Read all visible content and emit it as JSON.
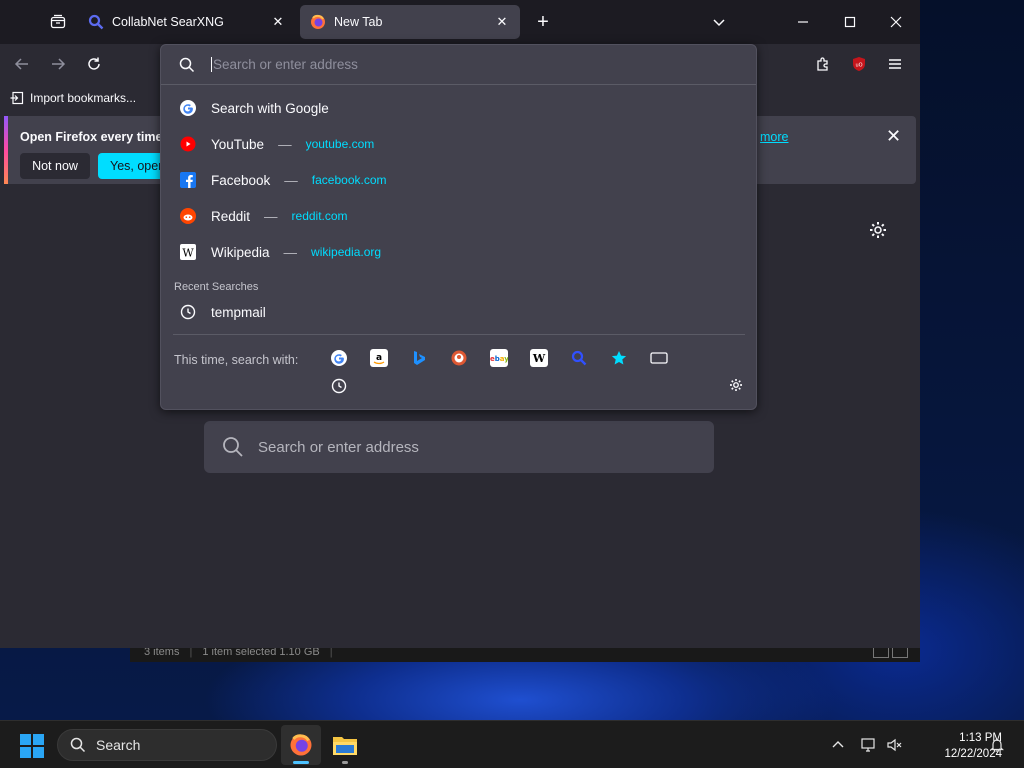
{
  "tabs": [
    {
      "title": "CollabNet SearXNG",
      "active": false
    },
    {
      "title": "New Tab",
      "active": true
    }
  ],
  "bookmarks": {
    "import_label": "Import bookmarks..."
  },
  "notification": {
    "message": "Open Firefox every time y",
    "link": "more",
    "not_now": "Not now",
    "yes": "Yes, open"
  },
  "urlbar": {
    "placeholder": "Search or enter address",
    "search_with_google": "Search with Google",
    "suggestions": [
      {
        "name": "YouTube",
        "url": "youtube.com",
        "icon": "youtube-icon"
      },
      {
        "name": "Facebook",
        "url": "facebook.com",
        "icon": "facebook-icon"
      },
      {
        "name": "Reddit",
        "url": "reddit.com",
        "icon": "reddit-icon"
      },
      {
        "name": "Wikipedia",
        "url": "wikipedia.org",
        "icon": "wikipedia-icon"
      }
    ],
    "separator": "—",
    "recent_label": "Recent Searches",
    "recent": [
      {
        "text": "tempmail"
      }
    ],
    "one_offs_label": "This time, search with:",
    "engines": [
      "google-icon",
      "amazon-icon",
      "bing-icon",
      "duckduckgo-icon",
      "ebay-icon",
      "wikipedia-icon",
      "searxng-icon",
      "bookmarks-icon",
      "tabs-icon",
      "history-icon"
    ]
  },
  "content": {
    "search_placeholder": "Search or enter address"
  },
  "explorer": {
    "items": "3 items",
    "selected": "1 item selected  1.10 GB"
  },
  "taskbar": {
    "search_label": "Search",
    "time": "1:13 PM",
    "date": "12/22/2024"
  },
  "colors": {
    "accent": "#00ddff",
    "toolbar": "#2b2a33",
    "panel": "#42414d"
  }
}
